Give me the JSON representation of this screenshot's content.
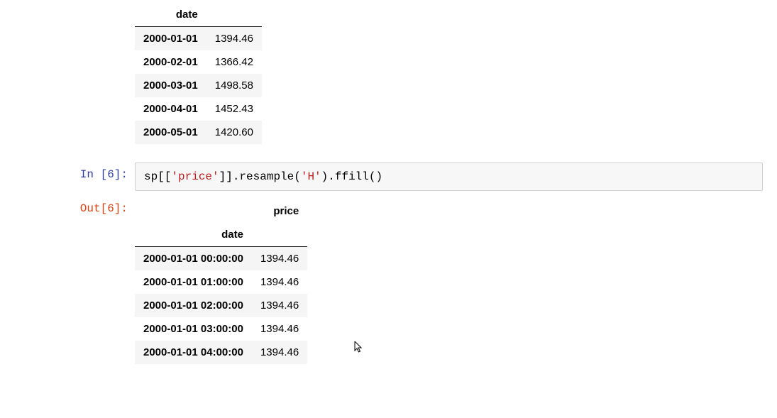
{
  "prompts": {
    "in6": "In [6]:",
    "out6": "Out[6]:"
  },
  "code6": {
    "pre1": "sp[[",
    "str1": "'price'",
    "mid": "]].resample(",
    "str2": "'H'",
    "post": ").ffill()"
  },
  "table1": {
    "index_name": "date",
    "rows": [
      {
        "date": "2000-01-01",
        "value": "1394.46"
      },
      {
        "date": "2000-02-01",
        "value": "1366.42"
      },
      {
        "date": "2000-03-01",
        "value": "1498.58"
      },
      {
        "date": "2000-04-01",
        "value": "1452.43"
      },
      {
        "date": "2000-05-01",
        "value": "1420.60"
      }
    ]
  },
  "table2": {
    "column_header": "price",
    "index_name": "date",
    "rows": [
      {
        "date": "2000-01-01 00:00:00",
        "value": "1394.46"
      },
      {
        "date": "2000-01-01 01:00:00",
        "value": "1394.46"
      },
      {
        "date": "2000-01-01 02:00:00",
        "value": "1394.46"
      },
      {
        "date": "2000-01-01 03:00:00",
        "value": "1394.46"
      },
      {
        "date": "2000-01-01 04:00:00",
        "value": "1394.46"
      }
    ]
  }
}
